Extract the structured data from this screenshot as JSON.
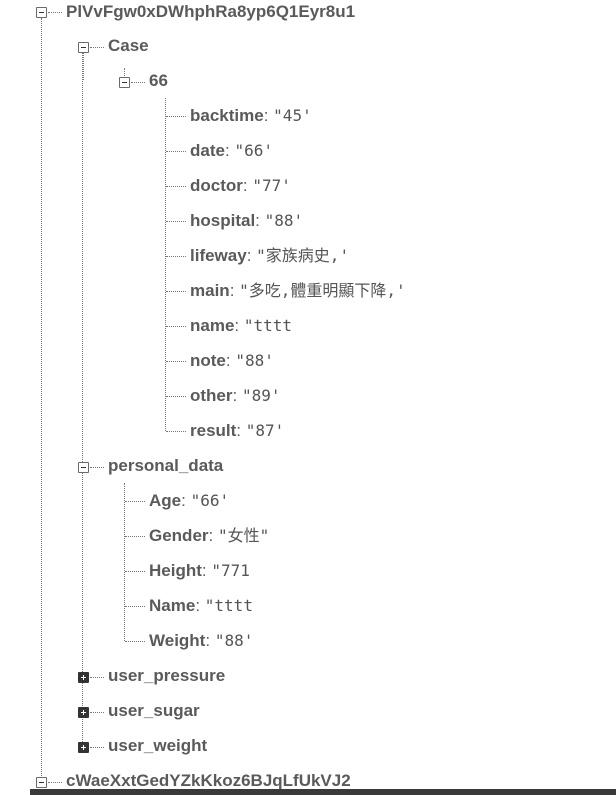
{
  "nodes": {
    "root1": "PlVvFgw0xDWhphRa8yp6Q1Eyr8u1",
    "case": "Case",
    "case66": "66",
    "personal": "personal_data",
    "user_pressure": "user_pressure",
    "user_sugar": "user_sugar",
    "user_weight": "user_weight",
    "root2": "cWaeXxtGedYZkKkoz6BJqLfUkVJ2"
  },
  "case66_fields": [
    {
      "key": "backtime",
      "value": "\"45'"
    },
    {
      "key": "date",
      "value": "\"66'"
    },
    {
      "key": "doctor",
      "value": "\"77'"
    },
    {
      "key": "hospital",
      "value": "\"88'"
    },
    {
      "key": "lifeway",
      "value": "\"家族病史,'"
    },
    {
      "key": "main",
      "value": "\"多吃,體重明顯下降,'"
    },
    {
      "key": "name",
      "value": "\"tttt"
    },
    {
      "key": "note",
      "value": "\"88'"
    },
    {
      "key": "other",
      "value": "\"89'"
    },
    {
      "key": "result",
      "value": "\"87'"
    }
  ],
  "personal_fields": [
    {
      "key": "Age",
      "value": "\"66'"
    },
    {
      "key": "Gender",
      "value": "\"女性\""
    },
    {
      "key": "Height",
      "value": "\"771"
    },
    {
      "key": "Name",
      "value": "\"tttt"
    },
    {
      "key": "Weight",
      "value": "\"88'"
    }
  ],
  "separator": ":",
  "icons": {
    "expanded": "collapse-minus-icon",
    "collapsed": "expand-plus-icon"
  },
  "colors": {
    "text": "#5a5a5a",
    "tree_line": "#777777",
    "plus_box": "#333333"
  }
}
